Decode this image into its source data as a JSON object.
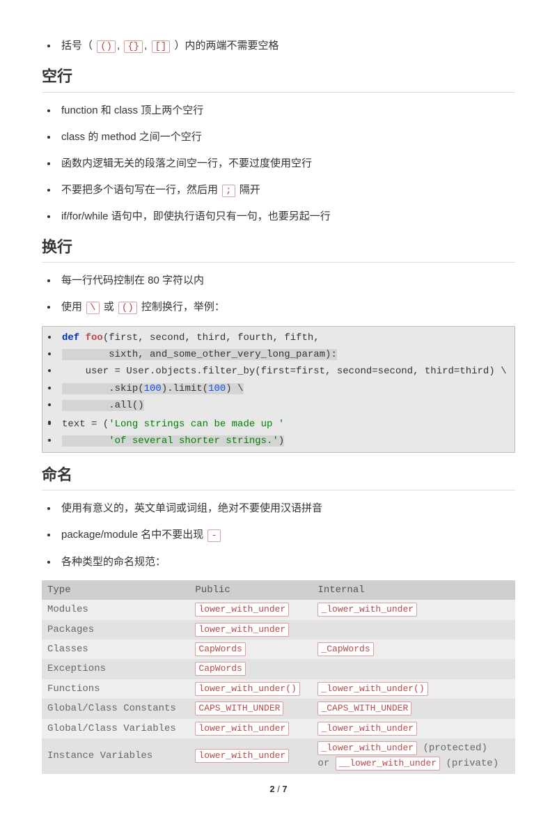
{
  "section1": {
    "items": [
      {
        "prefix": "括号（",
        "codes": [
          "()",
          "{}",
          "[]"
        ],
        "suffix": "）内的两端不需要空格"
      }
    ]
  },
  "headings": {
    "blank_lines": "空行",
    "line_break": "换行",
    "naming": "命名"
  },
  "blank_lines": {
    "i1": "function 和 class 顶上两个空行",
    "i2": "class 的 method 之间一个空行",
    "i3": "函数内逻辑无关的段落之间空一行，不要过度使用空行",
    "i4_pre": "不要把多个语句写在一行，然后用 ",
    "i4_code": ";",
    "i4_post": " 隔开",
    "i5": "if/for/while 语句中，即使执行语句只有一句，也要另起一行"
  },
  "line_break": {
    "i1": "每一行代码控制在 80 字符以内",
    "i2_pre": "使用 ",
    "i2_c1": "\\",
    "i2_mid": " 或 ",
    "i2_c2": "()",
    "i2_post": " 控制换行，举例："
  },
  "code": {
    "l1_kw": "def",
    "l1_fn": "foo",
    "l1_rest": "(first, second, third, fourth, fifth,",
    "l2": "        sixth, and_some_other_very_long_param):",
    "l3": "    user = User.objects.filter_by(first=first, second=second, third=third) \\",
    "l4_a": "        .skip(",
    "l4_n1": "100",
    "l4_b": ").limit(",
    "l4_n2": "100",
    "l4_c": ") \\",
    "l5": "        .all()",
    "l6": "",
    "l7_a": "text = (",
    "l7_s": "'Long strings can be made up '",
    "l8_pad": "        ",
    "l8_s": "'of several shorter strings.'",
    "l8_end": ")"
  },
  "naming": {
    "i1": "使用有意义的，英文单词或词组，绝对不要使用汉语拼音",
    "i2_pre": "package/module 名中不要出现 ",
    "i2_code": "-",
    "i3": "各种类型的命名规范："
  },
  "table": {
    "headers": [
      "Type",
      "Public",
      "Internal"
    ],
    "rows": [
      {
        "type": "Modules",
        "pub": "lower_with_under",
        "int": "_lower_with_under",
        "extra": ""
      },
      {
        "type": "Packages",
        "pub": "lower_with_under",
        "int": "",
        "extra": ""
      },
      {
        "type": "Classes",
        "pub": "CapWords",
        "int": "_CapWords",
        "extra": ""
      },
      {
        "type": "Exceptions",
        "pub": "CapWords",
        "int": "",
        "extra": ""
      },
      {
        "type": "Functions",
        "pub": "lower_with_under()",
        "int": "_lower_with_under()",
        "extra": ""
      },
      {
        "type": "Global/Class Constants",
        "pub": "CAPS_WITH_UNDER",
        "int": "_CAPS_WITH_UNDER",
        "extra": ""
      },
      {
        "type": "Global/Class Variables",
        "pub": "lower_with_under",
        "int": "_lower_with_under",
        "extra": ""
      },
      {
        "type": "Instance Variables",
        "pub": "lower_with_under",
        "int": "_lower_with_under",
        "int2": "__lower_with_under",
        "note1": "(protected)",
        "mid": "or",
        "note2": "(private)"
      }
    ]
  },
  "footer": {
    "page": "2",
    "sep": " / ",
    "total": "7"
  }
}
